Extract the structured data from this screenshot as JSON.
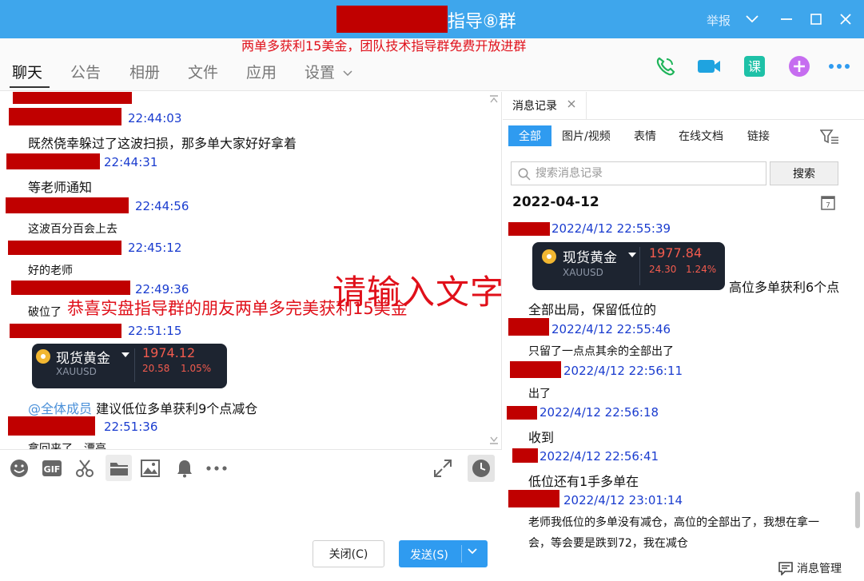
{
  "window": {
    "title": "指导⑧群",
    "report": "举报",
    "promo_banner": "两单多获利15美金，团队技术指导群免费开放进群"
  },
  "tabs": [
    {
      "label": "聊天"
    },
    {
      "label": "公告"
    },
    {
      "label": "相册"
    },
    {
      "label": "文件"
    },
    {
      "label": "应用"
    },
    {
      "label": "设置"
    }
  ],
  "toolbar_icons": [
    "phone-icon",
    "video-call-icon",
    "lesson-icon",
    "add-app-icon",
    "more-icon"
  ],
  "chat": {
    "messages": [
      {
        "time": "22:44:03",
        "text": "既然侥幸躲过了这波扫损，那多单大家好好拿着"
      },
      {
        "time": "22:44:31",
        "text": "等老师通知"
      },
      {
        "time": "22:44:56",
        "text": "这波百分百会上去"
      },
      {
        "time": "22:45:12",
        "text": "好的老师"
      },
      {
        "time": "22:49:36",
        "text": "破位了"
      },
      {
        "time": "22:51:15",
        "mention": "@全体成员",
        "text": "建议低位多单获利9个点减仓"
      },
      {
        "time": "22:51:36",
        "text": "拿回来了，漂亮"
      }
    ],
    "quote_card": {
      "name": "现货黄金",
      "code": "XAUUSD",
      "price": "1974.12",
      "change": "20.58",
      "change_pct": "1.05%"
    },
    "overlay_big": "请输入文字",
    "overlay_mid": "恭喜实盘指导群的朋友两单多完美获利15美金"
  },
  "input": {
    "close_label": "关闭(C)",
    "send_label": "发送(S)"
  },
  "history": {
    "tab_label": "消息记录",
    "filters": [
      "全部",
      "图片/视频",
      "表情",
      "在线文档",
      "链接"
    ],
    "search_placeholder": "搜索消息记录",
    "search_button": "搜索",
    "date": "2022-04-12",
    "quote_card": {
      "name": "现货黄金",
      "code": "XAUUSD",
      "price": "1977.84",
      "change": "24.30",
      "change_pct": "1.24%"
    },
    "entries": [
      {
        "time": "2022/4/12 22:55:39",
        "text": "高位多单获利6个点",
        "text2": "全部出局，保留低位的"
      },
      {
        "time": "2022/4/12 22:55:46",
        "text": "只留了一点点其余的全部出了"
      },
      {
        "time": "2022/4/12 22:56:11",
        "text": "出了"
      },
      {
        "time": "2022/4/12 22:56:18",
        "text": "收到"
      },
      {
        "time": "2022/4/12 22:56:41",
        "text": "低位还有1手多单在"
      },
      {
        "time": "2022/4/12 23:01:14",
        "text": "老师我低位的多单没有减仓，高位的全部出了，我想在拿一",
        "text2": "会，等会要是跌到72，我在减仓"
      }
    ],
    "manage_label": "消息管理"
  },
  "colors": {
    "titlebar": "#3ea6ec",
    "accent": "#2f9bf0",
    "timestamp": "#1a3ccf",
    "redact": "#c00000",
    "overlay": "#e0101a"
  }
}
